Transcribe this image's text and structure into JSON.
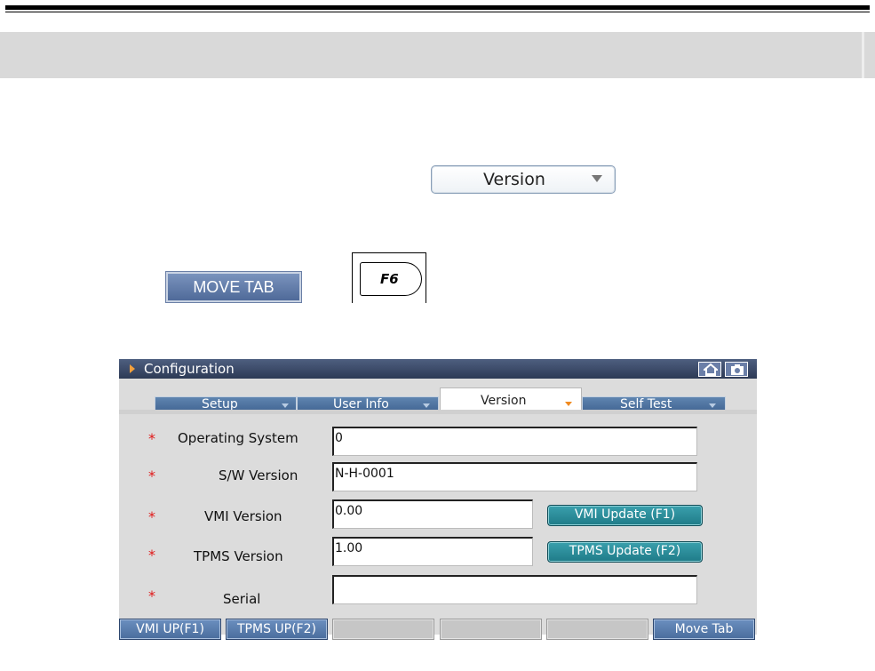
{
  "sample_dropdown": {
    "label": "Version"
  },
  "sample_move_tab": {
    "label": "MOVE TAB"
  },
  "sample_key": {
    "label": "F6"
  },
  "window": {
    "title": "Configuration",
    "tabs": [
      {
        "label": "Setup"
      },
      {
        "label": "User Info"
      },
      {
        "label": "Version",
        "active": true
      },
      {
        "label": "Self Test"
      }
    ],
    "fields": [
      {
        "star": "*",
        "label": "Operating System",
        "value": "0"
      },
      {
        "star": "*",
        "label": "S/W Version",
        "value": "N-H-0001"
      },
      {
        "star": "*",
        "label": "VMI Version",
        "value": "0.00",
        "button": "VMI Update (F1)"
      },
      {
        "star": "*",
        "label": "TPMS Version",
        "value": "1.00",
        "button": "TPMS Update (F2)"
      },
      {
        "star": "*",
        "label": "Serial",
        "value": ""
      }
    ],
    "function_keys": [
      "VMI UP(F1)",
      "TPMS UP(F2)",
      "",
      "",
      "",
      "Move Tab"
    ]
  },
  "colors": {
    "accent_star": "#e01818",
    "update_button": "#2a8c99",
    "tab_blue": "#4f72a0",
    "title_bar": "#3a4866"
  },
  "icons": [
    "play-icon",
    "home-icon",
    "camera-icon",
    "chevron-down-icon"
  ]
}
